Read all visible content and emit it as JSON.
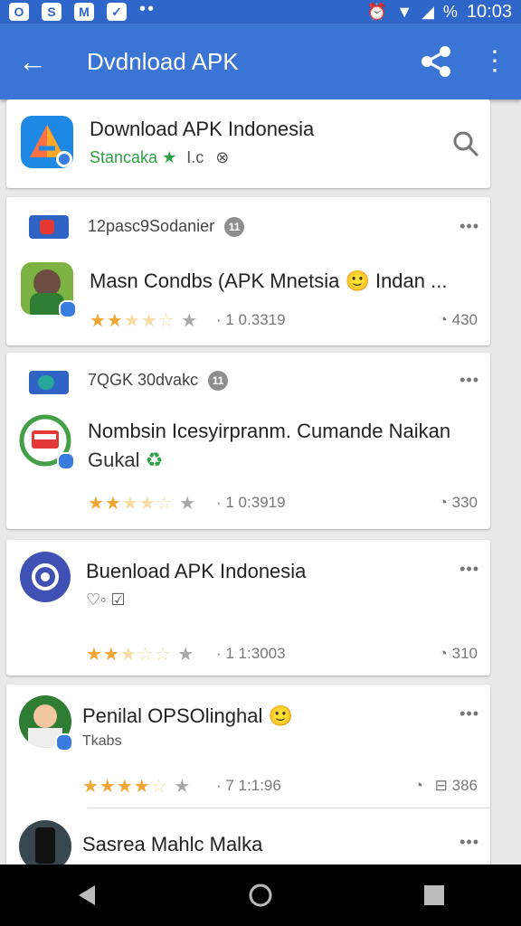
{
  "status_bar": {
    "time": "10:03",
    "battery": "%"
  },
  "app_bar": {
    "title": "Dvdnload APK",
    "back_icon": "arrow-left-icon",
    "share_icon": "share-icon",
    "menu_icon": "more-vert-icon"
  },
  "header_card": {
    "title": "Download APK Indonesia",
    "subtitle_green": "Stancaka",
    "subtitle_tail": "I.c",
    "search_icon": "search-icon"
  },
  "posts": [
    {
      "source": "12pasc9Sodanier",
      "source_badge": "11",
      "title": "Masn Condbs (APK Mnetsia 🙂 Indan ...",
      "rating_text": "· 1 0.3319",
      "comments": "430"
    },
    {
      "source": "7QGK 30dvakc",
      "source_badge": "11",
      "title": "Nombsin Icesyirpranm. Cumande Naikan",
      "title_line2": "Gukal",
      "rating_text": "· 1 0:3919",
      "comments": "330"
    },
    {
      "title": "Buenload APK Indonesia",
      "rating_text": "· 1 1:3003",
      "comments": "310"
    },
    {
      "title": "Penilal OPSOlinghal 🙂",
      "subtitle": "Tkabs",
      "rating_text": "· 7 1:1:96",
      "comments": "386"
    },
    {
      "title": "Sasrea Mahlc Malka"
    }
  ],
  "colors": {
    "app_bar": "#3a75d6",
    "status_bar": "#2f66c9",
    "star": "#f2a532",
    "green": "#2ea044"
  }
}
